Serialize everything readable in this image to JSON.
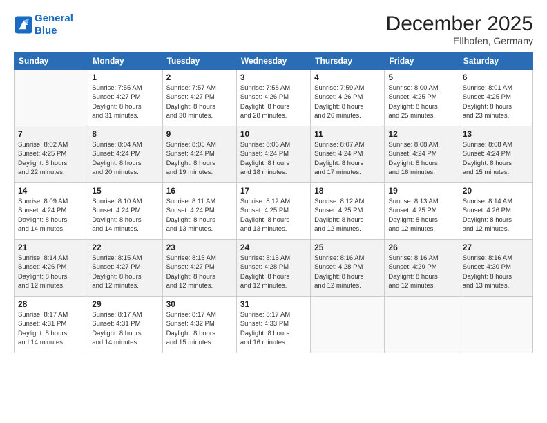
{
  "logo": {
    "line1": "General",
    "line2": "Blue"
  },
  "title": "December 2025",
  "subtitle": "Ellhofen, Germany",
  "weekdays": [
    "Sunday",
    "Monday",
    "Tuesday",
    "Wednesday",
    "Thursday",
    "Friday",
    "Saturday"
  ],
  "weeks": [
    [
      {
        "day": "",
        "info": ""
      },
      {
        "day": "1",
        "info": "Sunrise: 7:55 AM\nSunset: 4:27 PM\nDaylight: 8 hours\nand 31 minutes."
      },
      {
        "day": "2",
        "info": "Sunrise: 7:57 AM\nSunset: 4:27 PM\nDaylight: 8 hours\nand 30 minutes."
      },
      {
        "day": "3",
        "info": "Sunrise: 7:58 AM\nSunset: 4:26 PM\nDaylight: 8 hours\nand 28 minutes."
      },
      {
        "day": "4",
        "info": "Sunrise: 7:59 AM\nSunset: 4:26 PM\nDaylight: 8 hours\nand 26 minutes."
      },
      {
        "day": "5",
        "info": "Sunrise: 8:00 AM\nSunset: 4:25 PM\nDaylight: 8 hours\nand 25 minutes."
      },
      {
        "day": "6",
        "info": "Sunrise: 8:01 AM\nSunset: 4:25 PM\nDaylight: 8 hours\nand 23 minutes."
      }
    ],
    [
      {
        "day": "7",
        "info": "Sunrise: 8:02 AM\nSunset: 4:25 PM\nDaylight: 8 hours\nand 22 minutes."
      },
      {
        "day": "8",
        "info": "Sunrise: 8:04 AM\nSunset: 4:24 PM\nDaylight: 8 hours\nand 20 minutes."
      },
      {
        "day": "9",
        "info": "Sunrise: 8:05 AM\nSunset: 4:24 PM\nDaylight: 8 hours\nand 19 minutes."
      },
      {
        "day": "10",
        "info": "Sunrise: 8:06 AM\nSunset: 4:24 PM\nDaylight: 8 hours\nand 18 minutes."
      },
      {
        "day": "11",
        "info": "Sunrise: 8:07 AM\nSunset: 4:24 PM\nDaylight: 8 hours\nand 17 minutes."
      },
      {
        "day": "12",
        "info": "Sunrise: 8:08 AM\nSunset: 4:24 PM\nDaylight: 8 hours\nand 16 minutes."
      },
      {
        "day": "13",
        "info": "Sunrise: 8:08 AM\nSunset: 4:24 PM\nDaylight: 8 hours\nand 15 minutes."
      }
    ],
    [
      {
        "day": "14",
        "info": "Sunrise: 8:09 AM\nSunset: 4:24 PM\nDaylight: 8 hours\nand 14 minutes."
      },
      {
        "day": "15",
        "info": "Sunrise: 8:10 AM\nSunset: 4:24 PM\nDaylight: 8 hours\nand 14 minutes."
      },
      {
        "day": "16",
        "info": "Sunrise: 8:11 AM\nSunset: 4:24 PM\nDaylight: 8 hours\nand 13 minutes."
      },
      {
        "day": "17",
        "info": "Sunrise: 8:12 AM\nSunset: 4:25 PM\nDaylight: 8 hours\nand 13 minutes."
      },
      {
        "day": "18",
        "info": "Sunrise: 8:12 AM\nSunset: 4:25 PM\nDaylight: 8 hours\nand 12 minutes."
      },
      {
        "day": "19",
        "info": "Sunrise: 8:13 AM\nSunset: 4:25 PM\nDaylight: 8 hours\nand 12 minutes."
      },
      {
        "day": "20",
        "info": "Sunrise: 8:14 AM\nSunset: 4:26 PM\nDaylight: 8 hours\nand 12 minutes."
      }
    ],
    [
      {
        "day": "21",
        "info": "Sunrise: 8:14 AM\nSunset: 4:26 PM\nDaylight: 8 hours\nand 12 minutes."
      },
      {
        "day": "22",
        "info": "Sunrise: 8:15 AM\nSunset: 4:27 PM\nDaylight: 8 hours\nand 12 minutes."
      },
      {
        "day": "23",
        "info": "Sunrise: 8:15 AM\nSunset: 4:27 PM\nDaylight: 8 hours\nand 12 minutes."
      },
      {
        "day": "24",
        "info": "Sunrise: 8:15 AM\nSunset: 4:28 PM\nDaylight: 8 hours\nand 12 minutes."
      },
      {
        "day": "25",
        "info": "Sunrise: 8:16 AM\nSunset: 4:28 PM\nDaylight: 8 hours\nand 12 minutes."
      },
      {
        "day": "26",
        "info": "Sunrise: 8:16 AM\nSunset: 4:29 PM\nDaylight: 8 hours\nand 12 minutes."
      },
      {
        "day": "27",
        "info": "Sunrise: 8:16 AM\nSunset: 4:30 PM\nDaylight: 8 hours\nand 13 minutes."
      }
    ],
    [
      {
        "day": "28",
        "info": "Sunrise: 8:17 AM\nSunset: 4:31 PM\nDaylight: 8 hours\nand 14 minutes."
      },
      {
        "day": "29",
        "info": "Sunrise: 8:17 AM\nSunset: 4:31 PM\nDaylight: 8 hours\nand 14 minutes."
      },
      {
        "day": "30",
        "info": "Sunrise: 8:17 AM\nSunset: 4:32 PM\nDaylight: 8 hours\nand 15 minutes."
      },
      {
        "day": "31",
        "info": "Sunrise: 8:17 AM\nSunset: 4:33 PM\nDaylight: 8 hours\nand 16 minutes."
      },
      {
        "day": "",
        "info": ""
      },
      {
        "day": "",
        "info": ""
      },
      {
        "day": "",
        "info": ""
      }
    ]
  ]
}
